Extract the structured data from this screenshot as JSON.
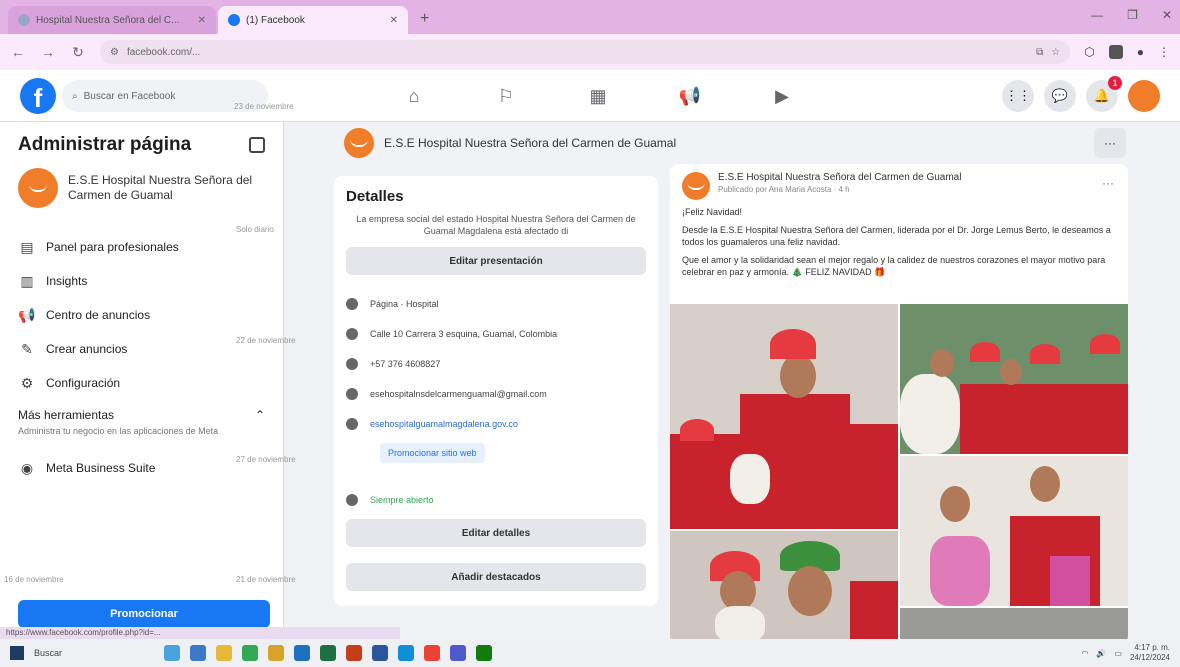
{
  "browser": {
    "tabs": [
      {
        "title": "Hospital Nuestra Señora del C...",
        "active": false
      },
      {
        "title": "(1) Facebook",
        "active": true
      }
    ],
    "new_tab": "+",
    "url": "facebook.com/...",
    "status_url": "https://www.facebook.com/profile.php?id=..."
  },
  "facebook": {
    "logo": "f",
    "search_placeholder": "Buscar en Facebook",
    "nav_icons": [
      "home-icon",
      "flag-icon",
      "marketplace-icon",
      "megaphone-icon",
      "video-icon"
    ],
    "notifications_badge": "1",
    "ghost_timestamps": [
      "23 de noviembre",
      "Solo diario",
      "22 de noviembre",
      "16 de noviembre",
      "21 de noviembre",
      "27 de noviembre"
    ]
  },
  "sidebar": {
    "title": "Administrar página",
    "page_name": "E.S.E Hospital Nuestra Señora del Carmen de Guamal",
    "items": [
      {
        "label": "Panel para profesionales",
        "icon": "dashboard-icon"
      },
      {
        "label": "Insights",
        "icon": "insights-icon"
      },
      {
        "label": "Centro de anuncios",
        "icon": "megaphone-icon"
      },
      {
        "label": "Crear anuncios",
        "icon": "create-ad-icon"
      },
      {
        "label": "Configuración",
        "icon": "gear-icon"
      }
    ],
    "more_tools": {
      "title": "Más herramientas",
      "desc": "Administra tu negocio en las aplicaciones de Meta"
    },
    "business_suite": "Meta Business Suite",
    "promote_label": "Promocionar"
  },
  "page_header": {
    "name": "E.S.E Hospital Nuestra Señora del Carmen de Guamal",
    "more": "···"
  },
  "details": {
    "heading": "Detalles",
    "description": "La empresa social del estado Hospital Nuestra Señora del Carmen de Guamal Magdalena está afectado di",
    "edit_presentation": "Editar presentación",
    "rows": [
      {
        "icon": "info-icon",
        "text": "Página · Hospital"
      },
      {
        "icon": "location-icon",
        "text": "Calle 10 Carrera 3 esquina, Guamal, Colombia"
      },
      {
        "icon": "phone-icon",
        "text": "+57 376 4608827"
      },
      {
        "icon": "mail-icon",
        "text": "esehospitalnsdelcarmenguamal@gmail.com"
      },
      {
        "icon": "globe-icon",
        "text": "esehospitalguamalmagdalena.gov.co"
      }
    ],
    "promote_website": "Promocionar sitio web",
    "hours": "Siempre abierto",
    "edit_details": "Editar detalles",
    "add_featured": "Añadir destacados"
  },
  "post": {
    "author": "E.S.E Hospital Nuestra Señora del Carmen de Guamal",
    "meta": "Publicado por Ana Maria Acosta · 4 h",
    "greeting": "¡Feliz Navidad!",
    "paragraph1": "Desde la E.S.E Hospital Nuestra Señora del Carmen, liderada por el Dr. Jorge Lemus Berto, le deseamos a todos los guamaleros una feliz navidad.",
    "paragraph2": "Que el amor y la solidaridad sean el mejor regalo y la calidez de nuestros corazones el mayor motivo para celebrar en paz y armonía. 🎄 FELIZ NAVIDAD 🎁",
    "dots": "···"
  },
  "taskbar": {
    "search": "Buscar",
    "tray_time": "4:17 p. m.",
    "tray_date": "24/12/2024"
  }
}
